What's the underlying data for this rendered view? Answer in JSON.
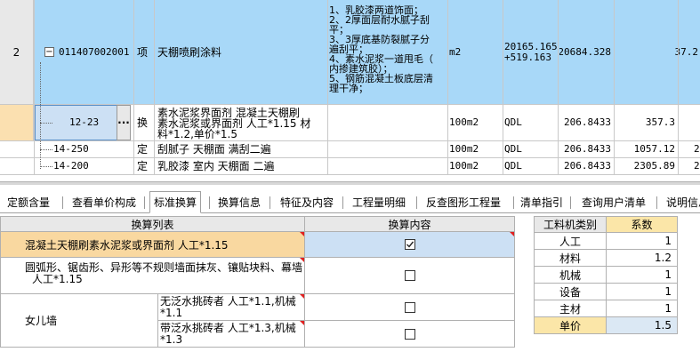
{
  "grid": {
    "bill": {
      "no": "2",
      "code": "011407002001",
      "type": "项",
      "name": "天棚喷刷涂料",
      "desc_lines": [
        "1、乳胶漆两道饰面；",
        "2、2厚面层耐水腻子刮",
        "平；",
        "3、3厚底基防裂腻子分",
        "遍刮平；",
        "4、素水泥浆一道甩毛（",
        "内掺建筑胶）；",
        "5、钢筋混凝土板底层清",
        "理干净；"
      ],
      "unit": "m2",
      "qty_line1": "20165.165",
      "qty_line2": "+519.163",
      "amount": "20684.328",
      "price": "37.2"
    },
    "quotas": [
      {
        "code": "12-23",
        "type": "换",
        "name_lines": [
          "素水泥浆界面剂  混凝土天棚刷",
          "素水泥浆或界面剂 人工*1.15 材",
          "料*1.2,单价*1.5"
        ],
        "unit": "100m2",
        "qtycode": "QDL",
        "qty": "206.8433",
        "price": "357.3",
        "more_label": "···"
      },
      {
        "code": "14-250",
        "type": "定",
        "name_lines": [
          "刮腻子 天棚面 满刮二遍"
        ],
        "unit": "100m2",
        "qtycode": "QDL",
        "qty": "206.8433",
        "price": "1057.12",
        "extra": "2"
      },
      {
        "code": "14-200",
        "type": "定",
        "name_lines": [
          "乳胶漆 室内 天棚面 二遍"
        ],
        "unit": "100m2",
        "qtycode": "QDL",
        "qty": "206.8433",
        "price": "2305.89",
        "extra": "2"
      }
    ]
  },
  "tabs": [
    "定额含量",
    "查看单价构成",
    "标准换算",
    "换算信息",
    "特征及内容",
    "工程量明细",
    "反查图形工程量",
    "清单指引",
    "查询用户清单",
    "说明信息"
  ],
  "conversion": {
    "header_list": "换算列表",
    "header_content": "换算内容",
    "rows": [
      {
        "text": "混凝土天棚刷素水泥浆或界面剂 人工*1.15",
        "checked": true
      },
      {
        "text_lines": [
          "圆弧形、锯齿形、异形等不规则墙面抹灰、镶贴块料、幕墙",
          "人工*1.15"
        ],
        "checked": false
      }
    ],
    "group": {
      "label": "女儿墙",
      "items": [
        {
          "lines": [
            "无泛水挑砖者 人工*1.1,机械",
            "*1.1"
          ],
          "checked": false
        },
        {
          "lines": [
            "带泛水挑砖者 人工*1.3,机械",
            "*1.3"
          ],
          "checked": false
        }
      ]
    }
  },
  "factors": {
    "header_type": "工料机类别",
    "header_coef": "系数",
    "rows": [
      {
        "label": "人工",
        "value": "1"
      },
      {
        "label": "材料",
        "value": "1.2"
      },
      {
        "label": "机械",
        "value": "1"
      },
      {
        "label": "设备",
        "value": "1"
      },
      {
        "label": "主材",
        "value": "1"
      },
      {
        "label": "单价",
        "value": "1.5"
      }
    ]
  },
  "colors": {
    "bill_row": "#a8d8f8",
    "selected": "#fbe0b0",
    "header": "#e8e8e8",
    "highlight": "#f9d8a0"
  }
}
